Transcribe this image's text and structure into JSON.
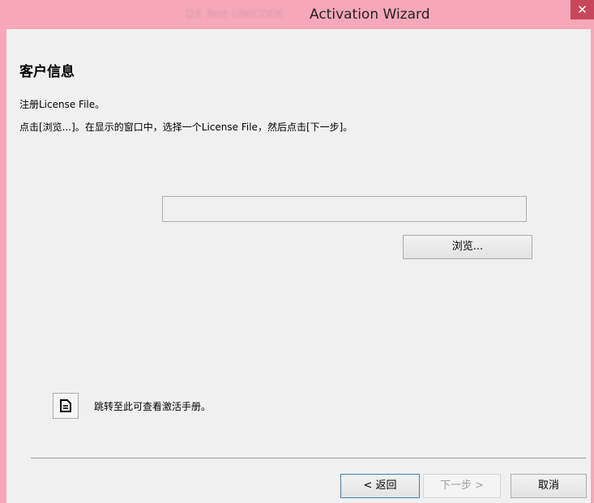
{
  "window": {
    "title_obscured": "DX Test-UNICODE",
    "title": "Activation Wizard",
    "close_label": "✕"
  },
  "page": {
    "heading": "客户信息",
    "line1": "注册License File。",
    "line2": "点击[浏览...]。在显示的窗口中，选择一个License File，然后点击[下一步]。"
  },
  "license_file": {
    "value": "",
    "placeholder": ""
  },
  "buttons": {
    "browse": "浏览...",
    "back": "< 返回",
    "next": "下一步 >",
    "cancel": "取消"
  },
  "help": {
    "icon": "document-icon",
    "text": "跳转至此可查看激活手册。"
  },
  "colors": {
    "titlebar": "#f7a8b8",
    "close": "#c9475a",
    "background": "#f0f0f0"
  }
}
